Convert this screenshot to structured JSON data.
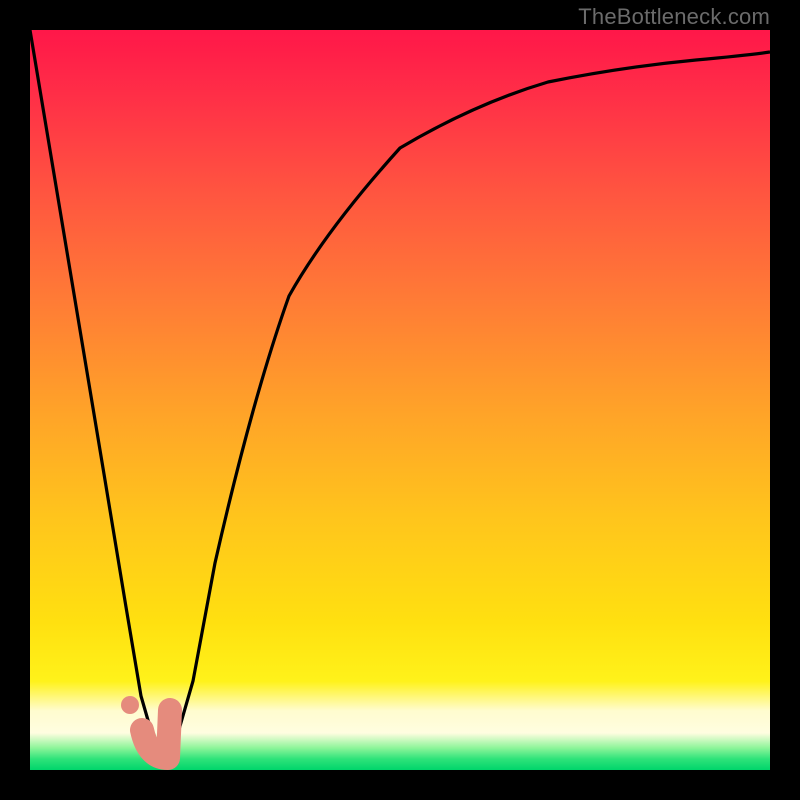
{
  "watermark": "TheBottleneck.com",
  "chart_data": {
    "type": "line",
    "title": "",
    "xlabel": "",
    "ylabel": "",
    "xlim": [
      0,
      100
    ],
    "ylim": [
      0,
      100
    ],
    "grid": false,
    "legend": false,
    "background": {
      "type": "vertical_gradient",
      "stops": [
        {
          "pos": 0,
          "color": "#ff1749"
        },
        {
          "pos": 22,
          "color": "#ff5540"
        },
        {
          "pos": 52,
          "color": "#ffa428"
        },
        {
          "pos": 80,
          "color": "#ffe010"
        },
        {
          "pos": 92,
          "color": "#fffccf"
        },
        {
          "pos": 100,
          "color": "#00d56b"
        }
      ]
    },
    "series": [
      {
        "name": "bottleneck-curve",
        "color": "#000000",
        "x": [
          0,
          5,
          10,
          13,
          15,
          17,
          18,
          20,
          22,
          25,
          30,
          35,
          40,
          50,
          60,
          70,
          80,
          90,
          100
        ],
        "y": [
          100,
          70,
          40,
          22,
          10,
          3,
          1,
          4,
          12,
          28,
          50,
          64,
          73,
          84,
          90,
          93,
          95,
          96,
          97
        ]
      }
    ],
    "markers": [
      {
        "name": "highlight-blob",
        "shape": "J",
        "color": "#e58b7d",
        "x": 16.5,
        "y": 4,
        "size": 6
      },
      {
        "name": "highlight-dot",
        "shape": "circle",
        "color": "#e58b7d",
        "x": 13.5,
        "y": 9,
        "size": 2
      }
    ]
  }
}
